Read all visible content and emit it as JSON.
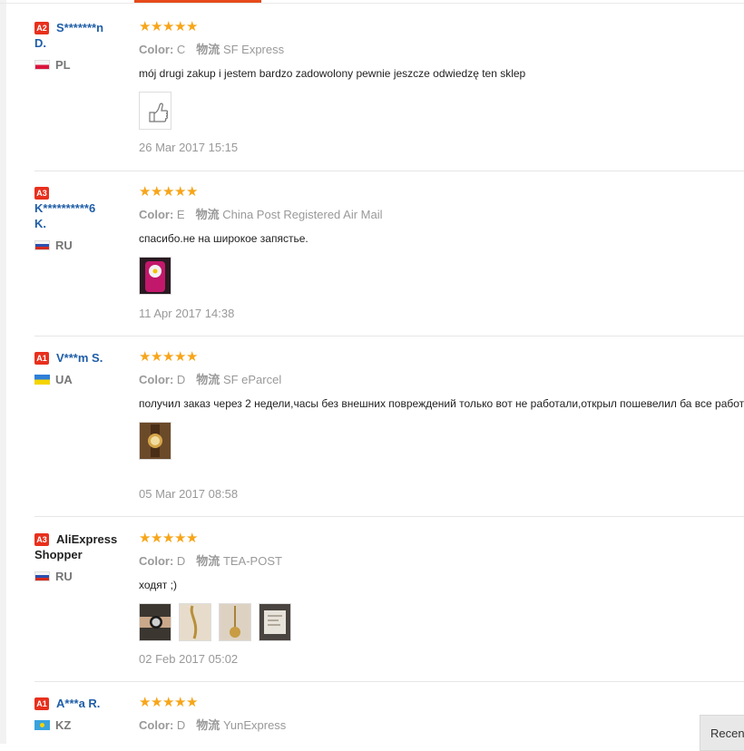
{
  "reviews": [
    {
      "badge": "A2",
      "name_line1": "S*******n",
      "name_line2": "D.",
      "country": "PL",
      "rating": 5,
      "color_label": "Color:",
      "color_value": "C",
      "logistics_label": "物流",
      "logistics_value": "SF Express",
      "comment": "mój drugi zakup i jestem bardzo zadowolony pewnie jeszcze odwiedzę ten sklep",
      "date": "26 Mar 2017 15:15",
      "photos": [
        "thumbs-up-sticker"
      ]
    },
    {
      "badge": "A3",
      "name_line1": "K**********6",
      "name_line2": "K.",
      "country": "RU",
      "rating": 5,
      "color_label": "Color:",
      "color_value": "E",
      "logistics_label": "物流",
      "logistics_value": "China Post Registered Air Mail",
      "comment": "спасибо.не на широкое запястье.",
      "date": "11 Apr 2017 14:38",
      "photos": [
        "flower-watch-photo"
      ]
    },
    {
      "badge": "A1",
      "name_line1": "V***m S.",
      "name_line2": "",
      "country": "UA",
      "rating": 5,
      "color_label": "Color:",
      "color_value": "D",
      "logistics_label": "物流",
      "logistics_value": "SF eParcel",
      "comment": "получил заказ через 2 недели,часы без внешних повреждений только вот не работали,открыл пошевелил ба все работает",
      "date": "05 Mar 2017 08:58",
      "photos": [
        "gold-watch-photo"
      ]
    },
    {
      "badge": "A3",
      "name_line1": "AliExpress",
      "name_line2": "Shopper",
      "country": "RU",
      "rating": 5,
      "color_label": "Color:",
      "color_value": "D",
      "logistics_label": "物流",
      "logistics_value": "TEA-POST",
      "comment": "ходят ;)",
      "date": "02 Feb 2017 05:02",
      "photos": [
        "wrist-watch-photo",
        "watch-chain-photo",
        "watch-pendant-photo",
        "package-photo"
      ]
    },
    {
      "badge": "A1",
      "name_line1": "A***a R.",
      "name_line2": "",
      "country": "KZ",
      "rating": 5,
      "color_label": "Color:",
      "color_value": "D",
      "logistics_label": "物流",
      "logistics_value": "YunExpress"
    }
  ],
  "recent_button": "Recent",
  "colors": {
    "badge": "#e8301d",
    "star": "#f7a519",
    "username": "#1f5ea8",
    "accent": "#e64a1a"
  }
}
